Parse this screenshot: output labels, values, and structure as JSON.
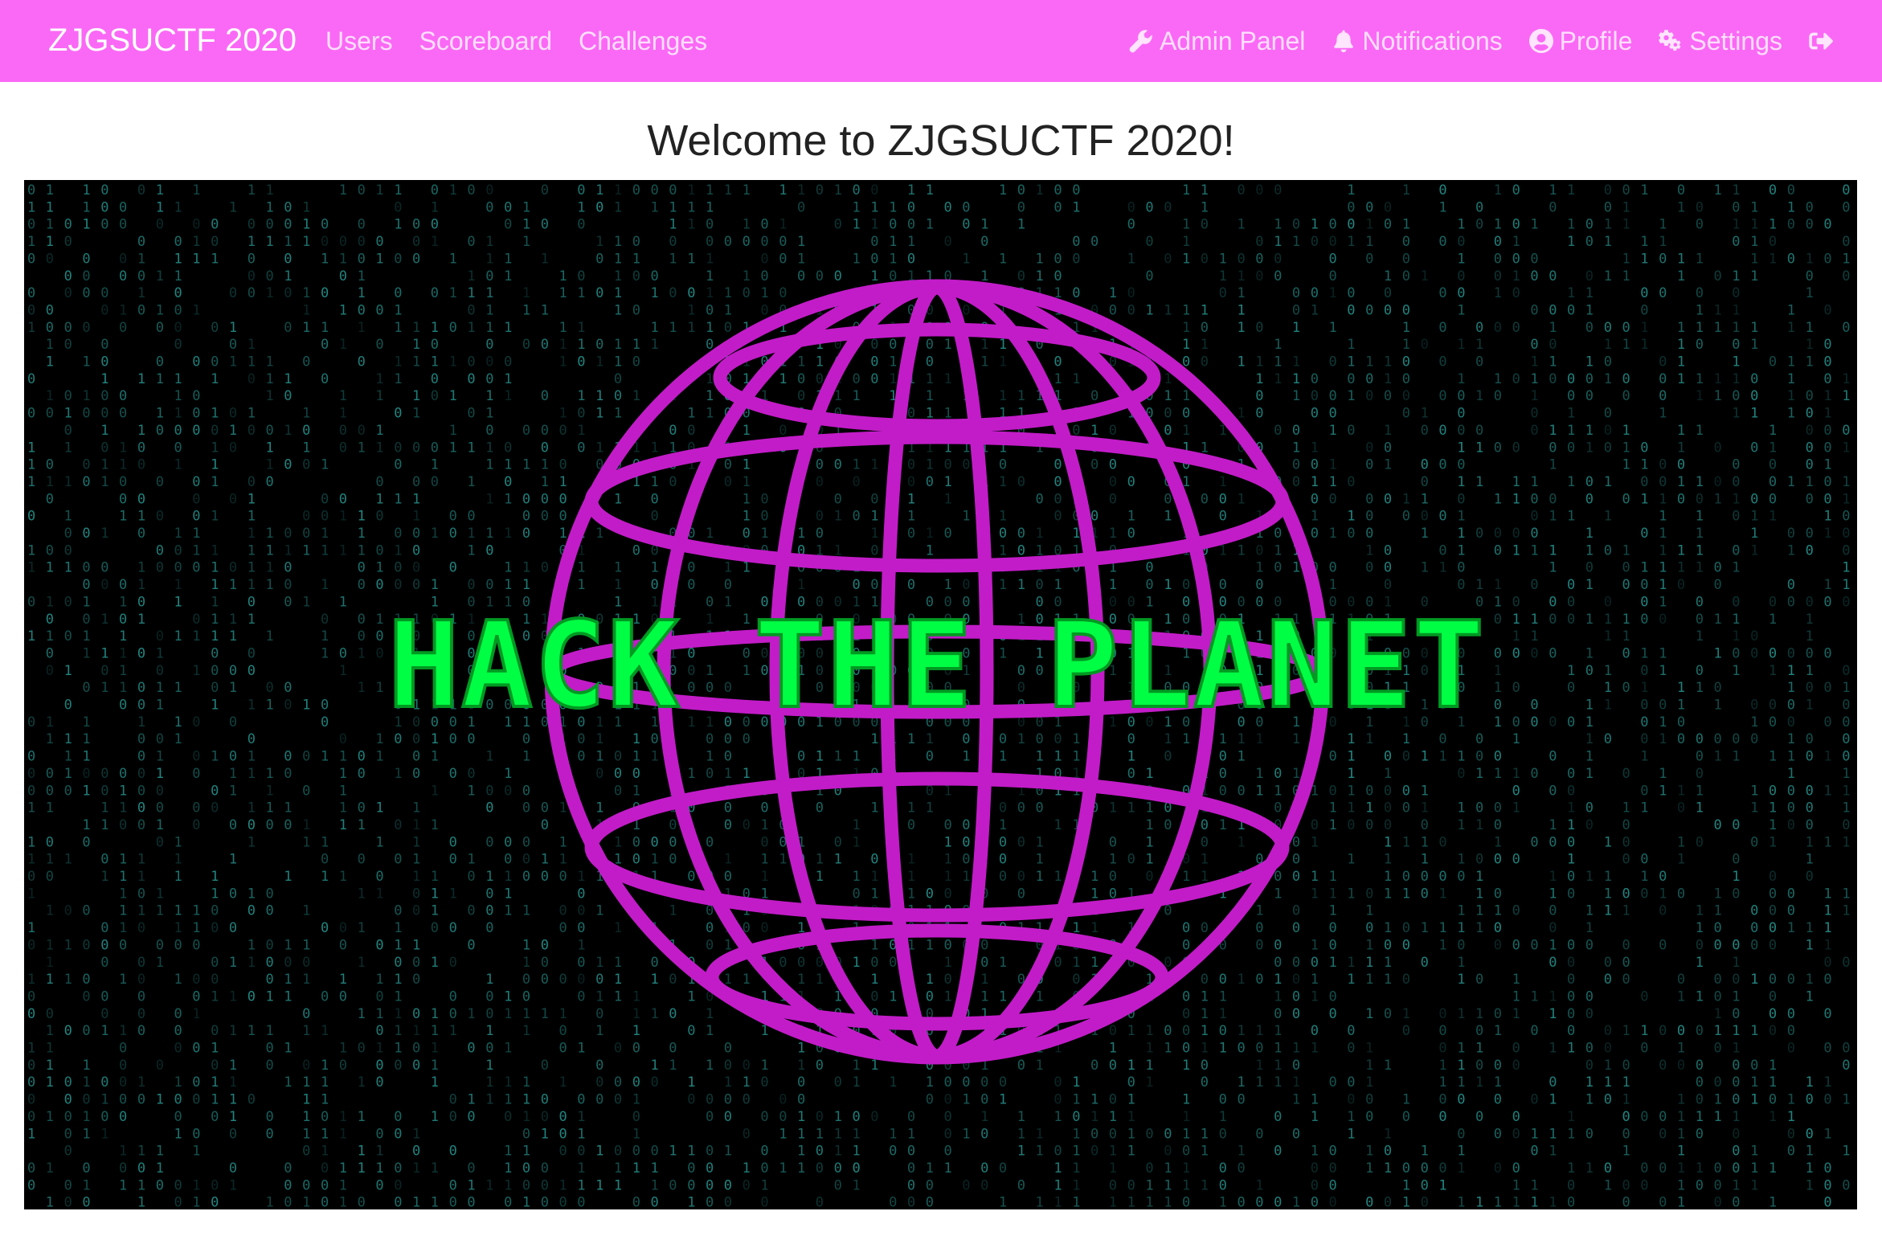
{
  "navbar": {
    "brand": "ZJGSUCTF 2020",
    "left_links": [
      {
        "label": "Users"
      },
      {
        "label": "Scoreboard"
      },
      {
        "label": "Challenges"
      }
    ],
    "right_links": [
      {
        "label": "Admin Panel",
        "icon": "wrench-icon"
      },
      {
        "label": "Notifications",
        "icon": "bell-icon"
      },
      {
        "label": "Profile",
        "icon": "user-circle-icon"
      },
      {
        "label": "Settings",
        "icon": "cogs-icon"
      },
      {
        "label": "",
        "icon": "sign-out-icon"
      }
    ],
    "background_color": "#fa69f5"
  },
  "main": {
    "title": "Welcome to ZJGSUCTF 2020!",
    "banner": {
      "text": "HACK THE PLANET",
      "text_color": "#00ff44",
      "globe_color": "#c21cc8",
      "binary_color": "#2fb7b0",
      "background_color": "#000000"
    }
  }
}
